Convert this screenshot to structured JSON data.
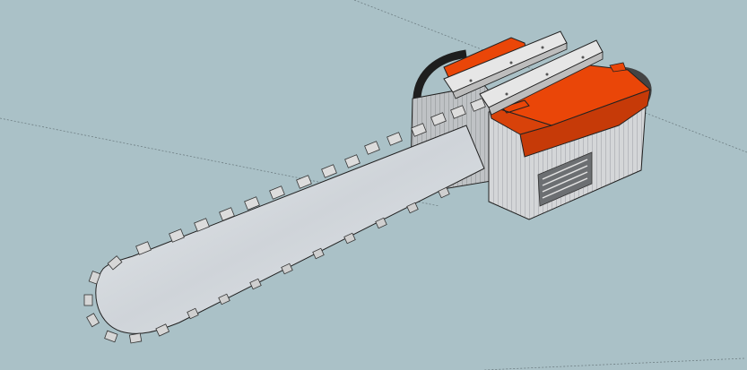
{
  "app": {
    "viewport": "3d-model-viewport"
  },
  "scene": {
    "background_color": "#aac1c7",
    "model": "chainsaw",
    "parts": {
      "housing_color": "#ea4608",
      "housing_shadow_color": "#c63a08",
      "body_color": "#d2d4d6",
      "bar_color": "#d7dbdf",
      "rail_color": "#e6e6e6",
      "edge_color": "#222222"
    }
  }
}
